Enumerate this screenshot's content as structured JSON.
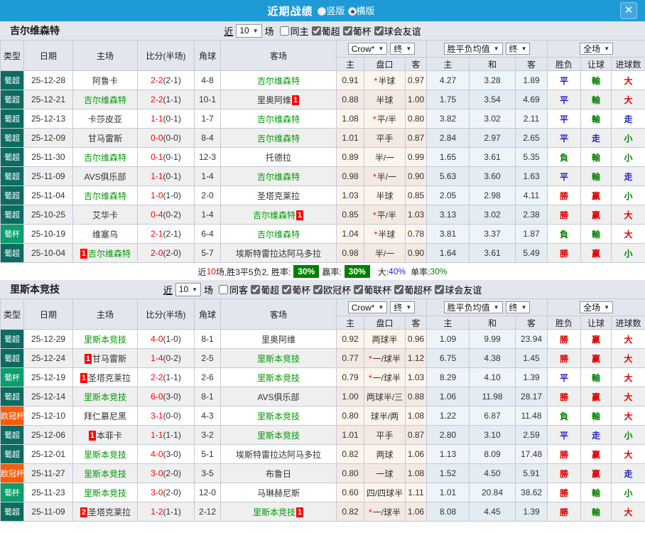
{
  "titlebar": {
    "title": "近期战绩",
    "radios": [
      {
        "label": "竖版",
        "selected": false
      },
      {
        "label": "横版",
        "selected": true
      }
    ],
    "close": "✕"
  },
  "ui": {
    "arrow": "▼",
    "star": "*"
  },
  "table_header": {
    "type": "类型",
    "date": "日期",
    "home": "主场",
    "score": "比分(半场)",
    "corner": "角球",
    "away": "客场",
    "crown_dd": "Crow*",
    "end_dd": "终",
    "avg_dd": "胜平负均值",
    "end_dd2": "终",
    "full_dd": "全场",
    "sub": {
      "h": "主",
      "handicap": "盘口",
      "a": "客",
      "avg_h": "主",
      "avg_d": "和",
      "avg_a": "客",
      "wl": "胜负",
      "let": "让球",
      "goals": "进球数"
    }
  },
  "colors": {
    "type_colors": {
      "葡超": "#0c6c60",
      "葡杯": "#0a9e6c",
      "欧冠杯": "#f75c0c"
    },
    "result_colors": {
      "勝": "#e00000",
      "赢": "#e00000",
      "大": "#e00000",
      "平": "#2222cc",
      "走": "#2222cc",
      "負": "#008000",
      "輸": "#008000",
      "小": "#008000"
    }
  },
  "sections": [
    {
      "team": "吉尔维森特",
      "filter": {
        "near": "近",
        "count": "10",
        "games": "场",
        "same": {
          "label": "同主",
          "checked": false
        },
        "leagues": [
          {
            "label": "葡超",
            "checked": true
          },
          {
            "label": "葡杯",
            "checked": true
          },
          {
            "label": "球会友谊",
            "checked": true
          }
        ]
      },
      "rows": [
        {
          "type": "葡超",
          "date": "25-12-28",
          "home": {
            "name": "阿鲁卡"
          },
          "score": "2-2",
          "half": "(2-1)",
          "corner": "4-8",
          "away": {
            "name": "吉尔维森特",
            "green": true
          },
          "o1": "0.91",
          "star": true,
          "hc": "半球",
          "o2": "0.97",
          "a1": "4.27",
          "a2": "3.28",
          "a3": "1.89",
          "r1": "平",
          "r2": "輸",
          "r3": "大"
        },
        {
          "type": "葡超",
          "date": "25-12-21",
          "home": {
            "name": "吉尔维森特",
            "green": true
          },
          "score": "2-2",
          "half": "(1-1)",
          "corner": "10-1",
          "away": {
            "name": "里奥阿维",
            "suf": "1"
          },
          "o1": "0.88",
          "star": false,
          "hc": "半球",
          "o2": "1.00",
          "a1": "1.75",
          "a2": "3.54",
          "a3": "4.69",
          "r1": "平",
          "r2": "輸",
          "r3": "大"
        },
        {
          "type": "葡超",
          "date": "25-12-13",
          "home": {
            "name": "卡莎皮亚"
          },
          "score": "1-1",
          "half": "(0-1)",
          "corner": "1-7",
          "away": {
            "name": "吉尔维森特",
            "green": true
          },
          "o1": "1.08",
          "star": true,
          "hc": "平/半",
          "o2": "0.80",
          "a1": "3.82",
          "a2": "3.02",
          "a3": "2.11",
          "r1": "平",
          "r2": "輸",
          "r3": "走"
        },
        {
          "type": "葡超",
          "date": "25-12-09",
          "home": {
            "name": "甘马雷斯"
          },
          "score": "0-0",
          "half": "(0-0)",
          "corner": "8-4",
          "away": {
            "name": "吉尔维森特",
            "green": true
          },
          "o1": "1.01",
          "star": false,
          "hc": "平手",
          "o2": "0.87",
          "a1": "2.84",
          "a2": "2.97",
          "a3": "2.65",
          "r1": "平",
          "r2": "走",
          "r3": "小"
        },
        {
          "type": "葡超",
          "date": "25-11-30",
          "home": {
            "name": "吉尔维森特",
            "green": true
          },
          "score": "0-1",
          "half": "(0-1)",
          "corner": "12-3",
          "away": {
            "name": "托德拉"
          },
          "o1": "0.89",
          "star": false,
          "hc": "半/一",
          "o2": "0.99",
          "a1": "1.65",
          "a2": "3.61",
          "a3": "5.35",
          "r1": "負",
          "r2": "輸",
          "r3": "小"
        },
        {
          "type": "葡超",
          "date": "25-11-09",
          "home": {
            "name": "AVS俱乐部"
          },
          "score": "1-1",
          "half": "(0-1)",
          "corner": "1-4",
          "away": {
            "name": "吉尔维森特",
            "green": true
          },
          "o1": "0.98",
          "star": true,
          "hc": "半/一",
          "o2": "0.90",
          "a1": "5.63",
          "a2": "3.60",
          "a3": "1.63",
          "r1": "平",
          "r2": "輸",
          "r3": "走"
        },
        {
          "type": "葡超",
          "date": "25-11-04",
          "home": {
            "name": "吉尔维森特",
            "green": true
          },
          "score": "1-0",
          "half": "(1-0)",
          "corner": "2-0",
          "away": {
            "name": "圣塔克莱拉"
          },
          "o1": "1.03",
          "star": false,
          "hc": "半球",
          "o2": "0.85",
          "a1": "2.05",
          "a2": "2.98",
          "a3": "4.11",
          "r1": "勝",
          "r2": "赢",
          "r3": "小"
        },
        {
          "type": "葡超",
          "date": "25-10-25",
          "home": {
            "name": "艾华卡"
          },
          "score": "0-4",
          "half": "(0-2)",
          "corner": "1-4",
          "away": {
            "name": "吉尔维森特",
            "green": true,
            "suf": "1"
          },
          "o1": "0.85",
          "star": true,
          "hc": "平/半",
          "o2": "1.03",
          "a1": "3.13",
          "a2": "3.02",
          "a3": "2.38",
          "r1": "勝",
          "r2": "赢",
          "r3": "大"
        },
        {
          "type": "葡杯",
          "date": "25-10-19",
          "home": {
            "name": "维塞乌"
          },
          "score": "2-1",
          "half": "(2-1)",
          "corner": "6-4",
          "away": {
            "name": "吉尔维森特",
            "green": true
          },
          "o1": "1.04",
          "star": true,
          "hc": "半球",
          "o2": "0.78",
          "a1": "3.81",
          "a2": "3.37",
          "a3": "1.87",
          "r1": "負",
          "r2": "輸",
          "r3": "大"
        },
        {
          "type": "葡超",
          "date": "25-10-04",
          "home": {
            "name": "吉尔维森特",
            "green": true,
            "pre": "1"
          },
          "score": "2-0",
          "half": "(2-0)",
          "corner": "5-7",
          "away": {
            "name": "埃斯特雷拉达阿马多拉"
          },
          "o1": "0.98",
          "star": false,
          "hc": "半/一",
          "o2": "0.90",
          "a1": "1.64",
          "a2": "3.61",
          "a3": "5.49",
          "r1": "勝",
          "r2": "赢",
          "r3": "小"
        }
      ],
      "summary": {
        "near": "近",
        "count": "10",
        "text": "场,胜3平5负2, 胜率:",
        "win_pct": "30%",
        "label2": "赢率:",
        "draw_pct": "30%",
        "label3": "大:",
        "big_pct": "40%",
        "label4": "单率:",
        "single_pct": "30%"
      }
    },
    {
      "team": "里斯本竞技",
      "filter": {
        "near": "近",
        "count": "10",
        "games": "场",
        "same": {
          "label": "同客",
          "checked": false
        },
        "leagues": [
          {
            "label": "葡超",
            "checked": true
          },
          {
            "label": "葡杯",
            "checked": true
          },
          {
            "label": "欧冠杯",
            "checked": true
          },
          {
            "label": "葡联杯",
            "checked": true
          },
          {
            "label": "葡超杯",
            "checked": true
          },
          {
            "label": "球会友谊",
            "checked": true
          }
        ]
      },
      "rows": [
        {
          "type": "葡超",
          "date": "25-12-29",
          "home": {
            "name": "里斯本竞技",
            "green": true
          },
          "score": "4-0",
          "half": "(1-0)",
          "corner": "8-1",
          "away": {
            "name": "里奥阿维"
          },
          "o1": "0.92",
          "star": false,
          "hc": "两球半",
          "o2": "0.96",
          "a1": "1.09",
          "a2": "9.99",
          "a3": "23.94",
          "r1": "勝",
          "r2": "赢",
          "r3": "大"
        },
        {
          "type": "葡超",
          "date": "25-12-24",
          "home": {
            "name": "甘马雷斯",
            "pre": "1"
          },
          "score": "1-4",
          "half": "(0-2)",
          "corner": "2-5",
          "away": {
            "name": "里斯本竞技",
            "green": true
          },
          "o1": "0.77",
          "star": true,
          "hc": "一/球半",
          "o2": "1.12",
          "a1": "6.75",
          "a2": "4.38",
          "a3": "1.45",
          "r1": "勝",
          "r2": "赢",
          "r3": "大"
        },
        {
          "type": "葡杯",
          "date": "25-12-19",
          "home": {
            "name": "圣塔克莱拉",
            "pre": "1"
          },
          "score": "2-2",
          "half": "(1-1)",
          "corner": "2-6",
          "away": {
            "name": "里斯本竞技",
            "green": true
          },
          "o1": "0.79",
          "star": true,
          "hc": "一/球半",
          "o2": "1.03",
          "a1": "8.29",
          "a2": "4.10",
          "a3": "1.39",
          "r1": "平",
          "r2": "輸",
          "r3": "大"
        },
        {
          "type": "葡超",
          "date": "25-12-14",
          "home": {
            "name": "里斯本竞技",
            "green": true
          },
          "score": "6-0",
          "half": "(3-0)",
          "corner": "8-1",
          "away": {
            "name": "AVS俱乐部"
          },
          "o1": "1.00",
          "star": false,
          "hc": "两球半/三",
          "o2": "0.88",
          "a1": "1.06",
          "a2": "11.98",
          "a3": "28.17",
          "r1": "勝",
          "r2": "赢",
          "r3": "大"
        },
        {
          "type": "欧冠杯",
          "date": "25-12-10",
          "home": {
            "name": "拜仁慕尼黑"
          },
          "score": "3-1",
          "half": "(0-0)",
          "corner": "4-3",
          "away": {
            "name": "里斯本竞技",
            "green": true
          },
          "o1": "0.80",
          "star": false,
          "hc": "球半/两",
          "o2": "1.08",
          "a1": "1.22",
          "a2": "6.87",
          "a3": "11.48",
          "r1": "負",
          "r2": "輸",
          "r3": "大"
        },
        {
          "type": "葡超",
          "date": "25-12-06",
          "home": {
            "name": "本菲卡",
            "pre": "1"
          },
          "score": "1-1",
          "half": "(1-1)",
          "corner": "3-2",
          "away": {
            "name": "里斯本竞技",
            "green": true
          },
          "o1": "1.01",
          "star": false,
          "hc": "平手",
          "o2": "0.87",
          "a1": "2.80",
          "a2": "3.10",
          "a3": "2.59",
          "r1": "平",
          "r2": "走",
          "r3": "小"
        },
        {
          "type": "葡超",
          "date": "25-12-01",
          "home": {
            "name": "里斯本竞技",
            "green": true
          },
          "score": "4-0",
          "half": "(3-0)",
          "corner": "5-1",
          "away": {
            "name": "埃斯特雷拉达阿马多拉"
          },
          "o1": "0.82",
          "star": false,
          "hc": "两球",
          "o2": "1.06",
          "a1": "1.13",
          "a2": "8.09",
          "a3": "17.48",
          "r1": "勝",
          "r2": "赢",
          "r3": "大"
        },
        {
          "type": "欧冠杯",
          "date": "25-11-27",
          "home": {
            "name": "里斯本竞技",
            "green": true
          },
          "score": "3-0",
          "half": "(2-0)",
          "corner": "3-5",
          "away": {
            "name": "布鲁日"
          },
          "o1": "0.80",
          "star": false,
          "hc": "一球",
          "o2": "1.08",
          "a1": "1.52",
          "a2": "4.50",
          "a3": "5.91",
          "r1": "勝",
          "r2": "赢",
          "r3": "走"
        },
        {
          "type": "葡杯",
          "date": "25-11-23",
          "home": {
            "name": "里斯本竞技",
            "green": true
          },
          "score": "3-0",
          "half": "(2-0)",
          "corner": "12-0",
          "away": {
            "name": "马琳赫尼斯"
          },
          "o1": "0.60",
          "star": false,
          "hc": "四/四球半",
          "o2": "1.11",
          "a1": "1.01",
          "a2": "20.84",
          "a3": "38.62",
          "r1": "勝",
          "r2": "輸",
          "r3": "小"
        },
        {
          "type": "葡超",
          "date": "25-11-09",
          "home": {
            "name": "圣塔克莱拉",
            "pre": "2"
          },
          "score": "1-2",
          "half": "(1-1)",
          "corner": "2-12",
          "away": {
            "name": "里斯本竞技",
            "green": true,
            "suf": "1"
          },
          "o1": "0.82",
          "star": true,
          "hc": "一/球半",
          "o2": "1.06",
          "a1": "8.08",
          "a2": "4.45",
          "a3": "1.39",
          "r1": "勝",
          "r2": "輸",
          "r3": "大"
        }
      ]
    }
  ]
}
